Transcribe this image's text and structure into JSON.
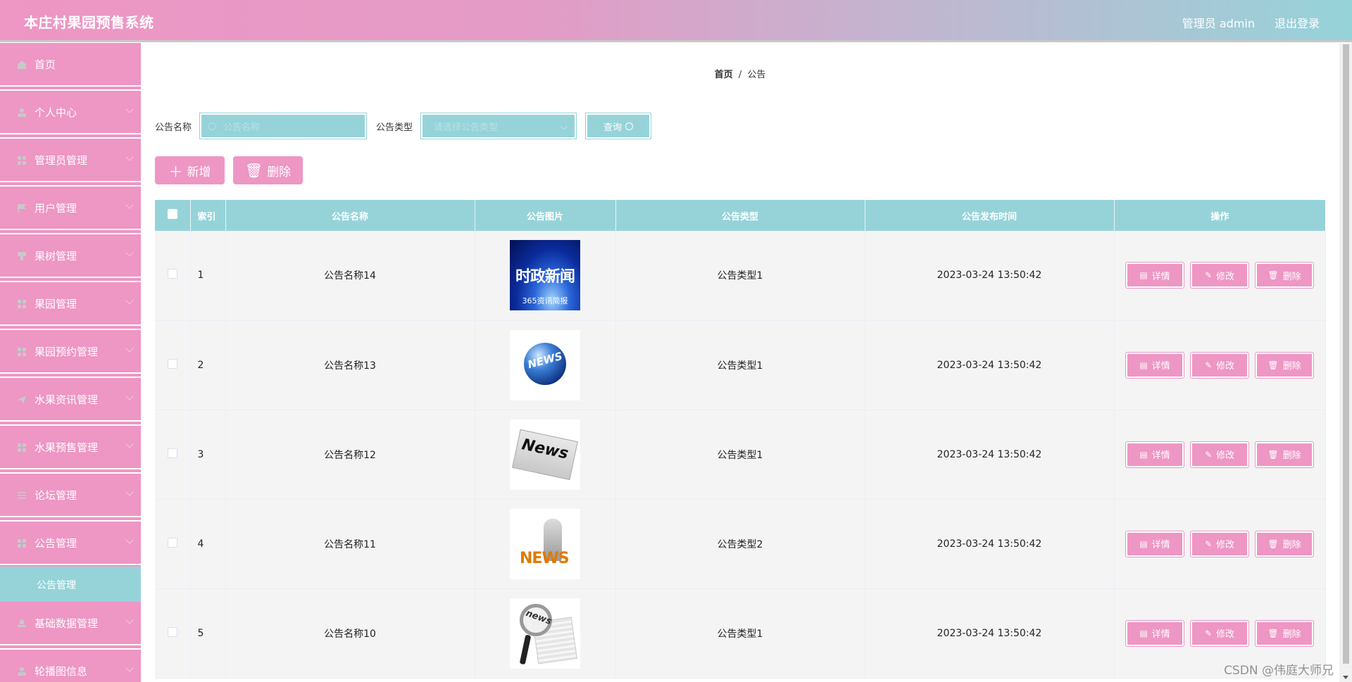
{
  "header": {
    "title": "本庄村果园预售系统",
    "user_label": "管理员 admin",
    "logout_label": "退出登录"
  },
  "sidebar": {
    "items": [
      {
        "label": "首页",
        "icon": "home-icon",
        "expandable": false
      },
      {
        "label": "个人中心",
        "icon": "user-icon",
        "expandable": true
      },
      {
        "label": "管理员管理",
        "icon": "grid-icon",
        "expandable": true
      },
      {
        "label": "用户管理",
        "icon": "flag-icon",
        "expandable": true
      },
      {
        "label": "果树管理",
        "icon": "tree-icon",
        "expandable": true
      },
      {
        "label": "果园管理",
        "icon": "grid-icon",
        "expandable": true
      },
      {
        "label": "果园预约管理",
        "icon": "grid-icon",
        "expandable": true
      },
      {
        "label": "水果资讯管理",
        "icon": "send-icon",
        "expandable": true
      },
      {
        "label": "水果预售管理",
        "icon": "grid-icon",
        "expandable": true
      },
      {
        "label": "论坛管理",
        "icon": "sliders-icon",
        "expandable": true
      },
      {
        "label": "公告管理",
        "icon": "grid-icon",
        "expandable": true,
        "expanded": true
      },
      {
        "label": "基础数据管理",
        "icon": "stamp-icon",
        "expandable": true
      },
      {
        "label": "轮播图信息",
        "icon": "user-icon",
        "expandable": true
      }
    ],
    "submenu": {
      "label": "公告管理",
      "active": true
    }
  },
  "breadcrumb": {
    "home": "首页",
    "separator": "/",
    "current": "公告"
  },
  "search": {
    "name_label": "公告名称",
    "name_placeholder": "公告名称",
    "name_value": "",
    "type_label": "公告类型",
    "type_placeholder": "请选择公告类型",
    "type_value": "",
    "query_label": "查询"
  },
  "actions": {
    "add_label": "新增",
    "delete_label": "删除"
  },
  "table": {
    "columns": [
      "索引",
      "公告名称",
      "公告图片",
      "公告类型",
      "公告发布时间",
      "操作"
    ],
    "rows": [
      {
        "index": "1",
        "name": "公告名称14",
        "image": "时政新闻 365资讯简报",
        "type": "公告类型1",
        "time": "2023-03-24 13:50:42"
      },
      {
        "index": "2",
        "name": "公告名称13",
        "image": "NEWS globe",
        "type": "公告类型1",
        "time": "2023-03-24 13:50:42"
      },
      {
        "index": "3",
        "name": "公告名称12",
        "image": "News newspaper",
        "type": "公告类型1",
        "time": "2023-03-24 13:50:42"
      },
      {
        "index": "4",
        "name": "公告名称11",
        "image": "NEWS figure",
        "type": "公告类型2",
        "time": "2023-03-24 13:50:42"
      },
      {
        "index": "5",
        "name": "公告名称10",
        "image": "news magnifier",
        "type": "公告类型1",
        "time": "2023-03-24 13:50:42"
      }
    ],
    "row_actions": {
      "detail": "详情",
      "edit": "修改",
      "delete": "删除"
    }
  },
  "thumbs": {
    "t1_big": "时政新闻",
    "t1_small": "365资讯简报",
    "t2_text": "NEWS",
    "t3_text": "News",
    "t4_text": "NEWS",
    "t5_text": "news"
  },
  "watermark": "CSDN @伟庭大师兄",
  "colors": {
    "pink": "#ee96c4",
    "teal": "#96d3d9",
    "row_bg": "#f4f4f4"
  }
}
